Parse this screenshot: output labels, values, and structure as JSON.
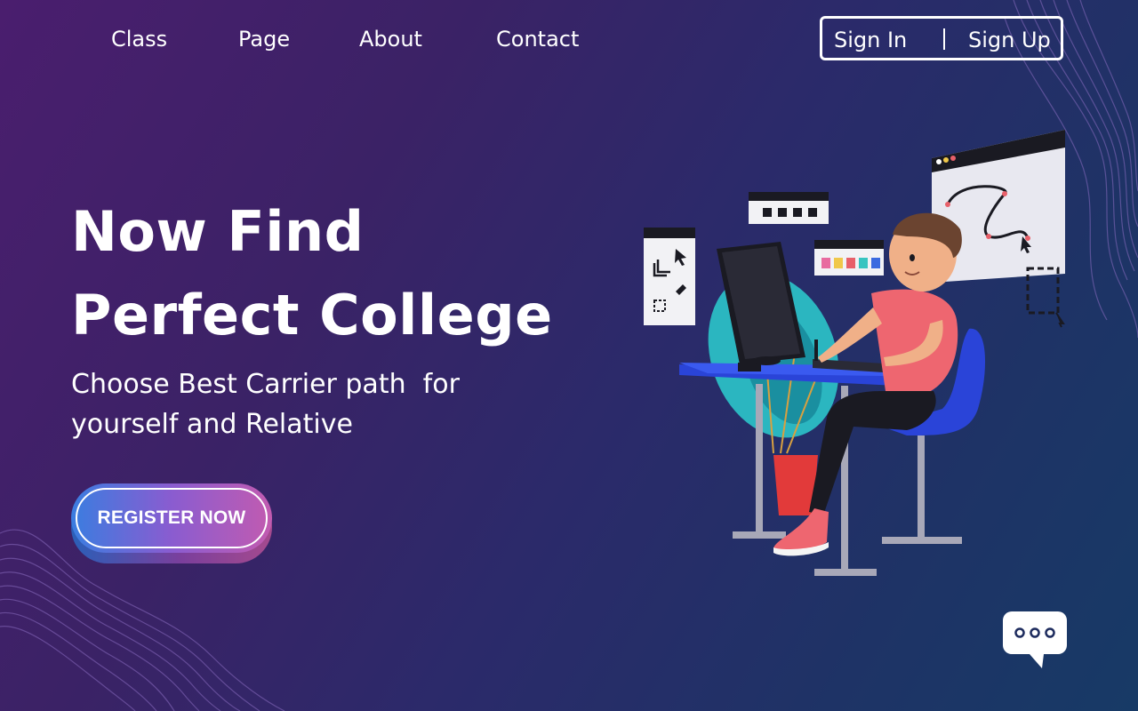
{
  "nav": {
    "links": [
      {
        "label": "Class"
      },
      {
        "label": "Page"
      },
      {
        "label": "About"
      },
      {
        "label": "Contact"
      }
    ]
  },
  "auth": {
    "sign_in": "Sign In",
    "sign_up": "Sign Up"
  },
  "hero": {
    "title_line1": "Now Find",
    "title_line2": "Perfect College",
    "subtitle_line1": "Choose Best Carrier path  for",
    "subtitle_line2": "yourself and Relative",
    "cta_label": "REGISTER NOW"
  },
  "illustration": {
    "icon": "designer-at-desk-illustration"
  },
  "chat": {
    "icon": "chat-bubble-icon"
  },
  "colors": {
    "background_start": "#4a1e6e",
    "background_end": "#173a66",
    "cta_start": "#3a7de0",
    "cta_end": "#c25bb0",
    "text": "#ffffff"
  }
}
